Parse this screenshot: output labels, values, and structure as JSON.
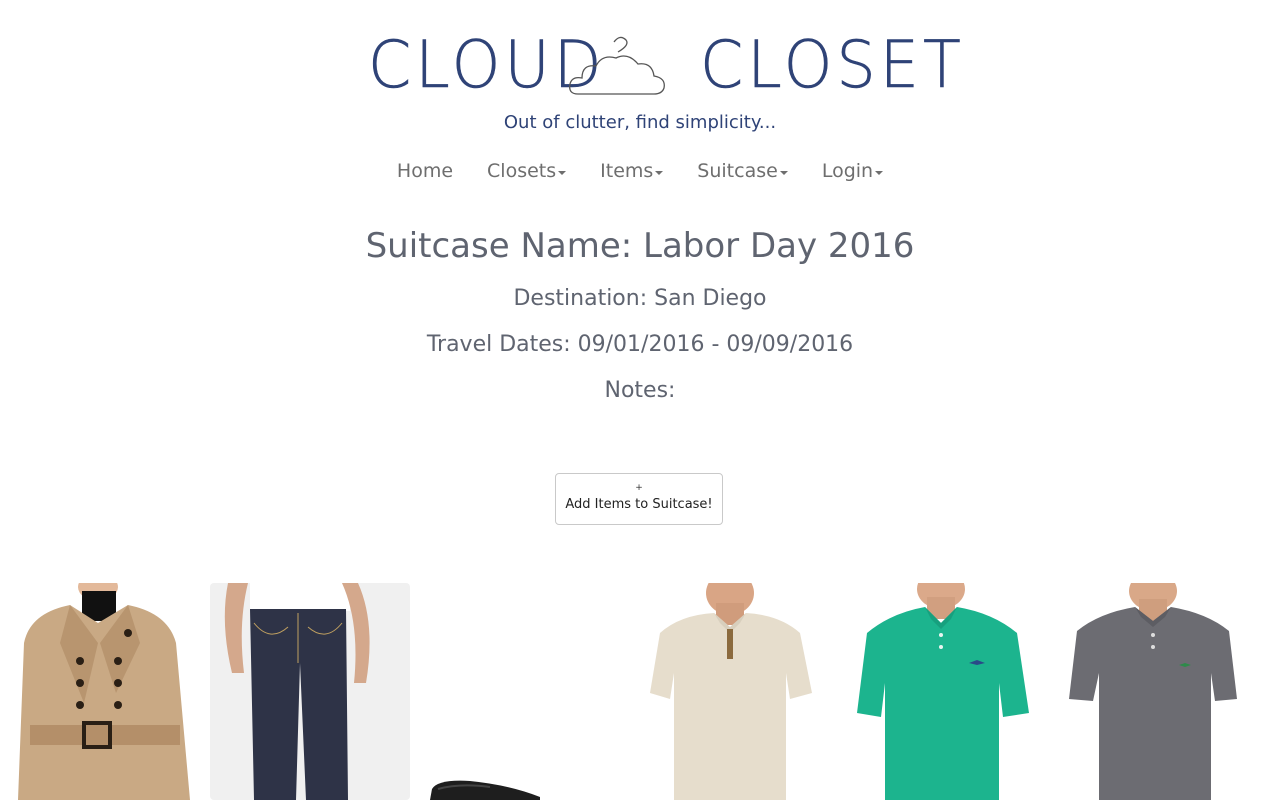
{
  "logo": {
    "left_word": "CLOUD",
    "right_word": "CLOSET",
    "icon": "cloud-hanger-icon"
  },
  "tagline": "Out of clutter, find simplicity...",
  "nav": {
    "items": [
      {
        "label": "Home",
        "has_dropdown": false
      },
      {
        "label": "Closets",
        "has_dropdown": true
      },
      {
        "label": "Items",
        "has_dropdown": true
      },
      {
        "label": "Suitcase",
        "has_dropdown": true
      },
      {
        "label": "Login",
        "has_dropdown": true
      }
    ]
  },
  "suitcase": {
    "name_line": "Suitcase Name: Labor Day 2016",
    "destination_line": "Destination: San Diego",
    "dates_line": "Travel Dates: 09/01/2016 - 09/09/2016",
    "notes_line": "Notes:"
  },
  "add_button": {
    "icon": "plus-icon",
    "label": "Add Items to Suitcase!"
  },
  "items": [
    {
      "kind": "trench-coat",
      "color": "#c9a984"
    },
    {
      "kind": "dark-jeans",
      "color": "#2e3347"
    },
    {
      "kind": "loafer-shoe",
      "color": "#1e1e1e"
    },
    {
      "kind": "cream-polo",
      "color": "#e6ddcc"
    },
    {
      "kind": "green-polo",
      "color": "#1cb48e"
    },
    {
      "kind": "gray-polo",
      "color": "#6c6c72"
    }
  ],
  "colors": {
    "brand": "#2f4377",
    "text": "#5f6470",
    "nav": "#6e6e6e"
  }
}
